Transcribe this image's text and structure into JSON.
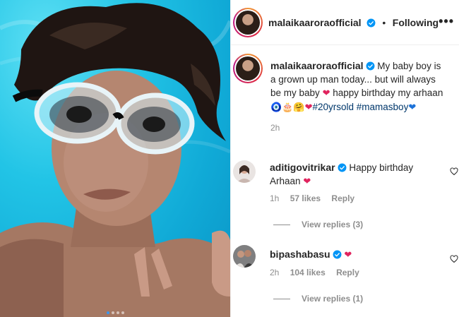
{
  "post": {
    "author": "malaikaaroraofficial",
    "following_label": "Following",
    "separator": "•",
    "more_glyph": "•••",
    "caption": "My baby boy is a grown up man today... but will always be my baby",
    "caption_tail": "happy birthday my arhaan",
    "caption_emojis": "🧿🎂🤗",
    "hashtags": [
      "#20yrsold",
      "#mamasboy"
    ],
    "time_ago": "2h",
    "carousel_dots": 4,
    "active_dot": 0
  },
  "comments": [
    {
      "username": "aditigovitrikar",
      "text": "Happy birthday Arhaan",
      "time_ago": "1h",
      "likes": "57 likes",
      "reply_label": "Reply",
      "view_replies": "View replies (3)"
    },
    {
      "username": "bipashabasu",
      "text": "",
      "time_ago": "2h",
      "likes": "104 likes",
      "reply_label": "Reply",
      "view_replies": "View replies (1)"
    }
  ],
  "icons": {
    "verified": "verified-badge-icon",
    "more": "more-options-icon",
    "like": "heart-outline-icon"
  },
  "colors": {
    "verified_blue": "#0095f6",
    "hashtag": "#00376b",
    "heart_red": "#e0245e",
    "pool_water": "#22c4e6"
  }
}
